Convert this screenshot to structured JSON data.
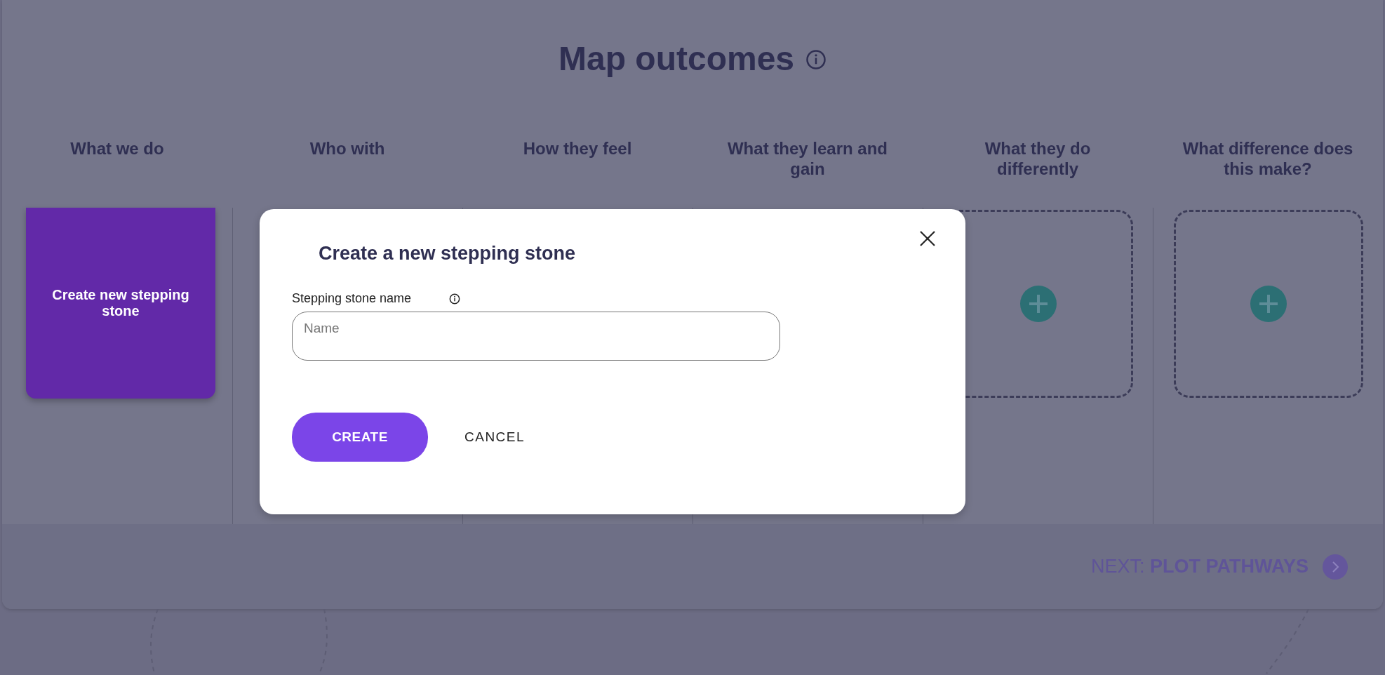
{
  "page": {
    "title": "Map outcomes"
  },
  "columns": [
    {
      "heading": "What we do",
      "card": {
        "kind": "create",
        "label": "Create new stepping stone"
      }
    },
    {
      "heading": "Who with"
    },
    {
      "heading": "How they feel"
    },
    {
      "heading": "What they learn and gain"
    },
    {
      "heading": "What they do differently",
      "card": {
        "kind": "add"
      }
    },
    {
      "heading": "What difference does this make?",
      "card": {
        "kind": "add"
      }
    }
  ],
  "next": {
    "prefix": "NEXT:",
    "label": "PLOT PATHWAYS"
  },
  "dialog": {
    "title": "Create a new stepping stone",
    "field": {
      "label": "Stepping stone name",
      "placeholder": "Name"
    },
    "buttons": [
      {
        "label": "CREATE",
        "kind": "primary"
      },
      {
        "label": "CANCEL",
        "kind": "text"
      }
    ]
  }
}
